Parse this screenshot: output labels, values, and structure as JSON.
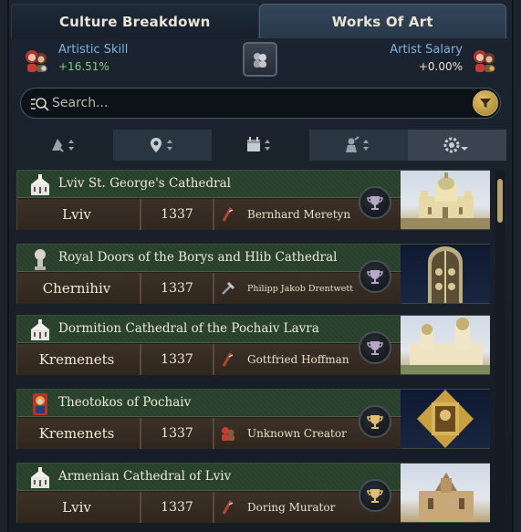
{
  "tabs": [
    {
      "label": "Culture Breakdown",
      "active": false
    },
    {
      "label": "Works Of Art",
      "active": true
    }
  ],
  "stats": {
    "left": {
      "label": "Artistic Skill",
      "value": "+16.51%",
      "icon": "artists-portrait-icon"
    },
    "right": {
      "label": "Artist Salary",
      "value": "+0.00%",
      "icon": "artists-portrait-icon"
    },
    "center_button_icon": "two-people-icon"
  },
  "search": {
    "placeholder": "Search...",
    "value": ""
  },
  "sort_bar": [
    "art-type-sort-icon",
    "location-pin-sort-icon",
    "calendar-sort-icon",
    "artist-sort-icon",
    "settings-dropdown-icon"
  ],
  "works": [
    {
      "title": "Lviv St. George's Cathedral",
      "location": "Lviv",
      "year": "1337",
      "artist": "Bernhard Meretyn",
      "artist_type": "brush-icon",
      "type_icon": "cathedral-icon",
      "trophy": "silver"
    },
    {
      "title": "Royal Doors of the Borys and Hlib Cathedral",
      "location": "Chernihiv",
      "year": "1337",
      "artist": "Philipp Jakob Drentwett",
      "artist_type": "hammer-icon",
      "type_icon": "sculpture-icon",
      "trophy": "silver"
    },
    {
      "title": "Dormition Cathedral of the Pochaiv Lavra",
      "location": "Kremenets",
      "year": "1337",
      "artist": "Gottfried Hoffman",
      "artist_type": "brush-icon",
      "type_icon": "cathedral-icon",
      "trophy": "silver"
    },
    {
      "title": "Theotokos of Pochaiv",
      "location": "Kremenets",
      "year": "1337",
      "artist": "Unknown Creator",
      "artist_type": "people-icon",
      "type_icon": "icon-painting-icon",
      "trophy": "gold"
    },
    {
      "title": "Armenian Cathedral of Lviv",
      "location": "Lviv",
      "year": "1337",
      "artist": "Doring Murator",
      "artist_type": "brush-icon",
      "type_icon": "cathedral-icon",
      "trophy": "gold"
    }
  ],
  "colors": {
    "accent_blue": "#7fb3e0",
    "positive_green": "#7fd07a",
    "gold": "#d8b45a",
    "card_green": "#2d4430"
  }
}
